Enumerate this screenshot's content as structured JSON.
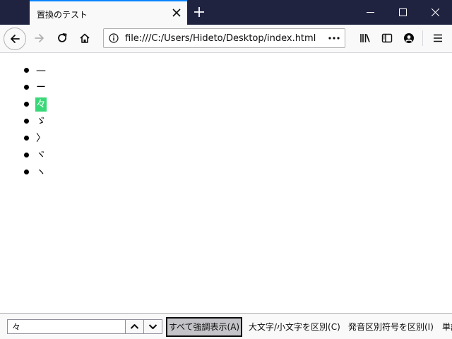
{
  "tab": {
    "title": "置換のテスト"
  },
  "urlbar": {
    "url": "file:///C:/Users/Hideto/Desktop/index.html"
  },
  "list_items": [
    {
      "text": "—",
      "highlighted": false
    },
    {
      "text": "ー",
      "highlighted": false
    },
    {
      "text": "々",
      "highlighted": true
    },
    {
      "text": "ゞ",
      "highlighted": false
    },
    {
      "text": "〉",
      "highlighted": false
    },
    {
      "text": "ヾ",
      "highlighted": false
    },
    {
      "text": "ヽ",
      "highlighted": false
    }
  ],
  "findbar": {
    "query": "々",
    "highlight_all": "すべて強調表示(A)",
    "match_case": "大文字/小文字を区別(C)",
    "match_diacritics": "発音区別符号を区別(I)",
    "whole_words": "単語"
  },
  "colors": {
    "titlebar": "#202340",
    "accent": "#0a84ff",
    "highlight": "#38d878"
  }
}
